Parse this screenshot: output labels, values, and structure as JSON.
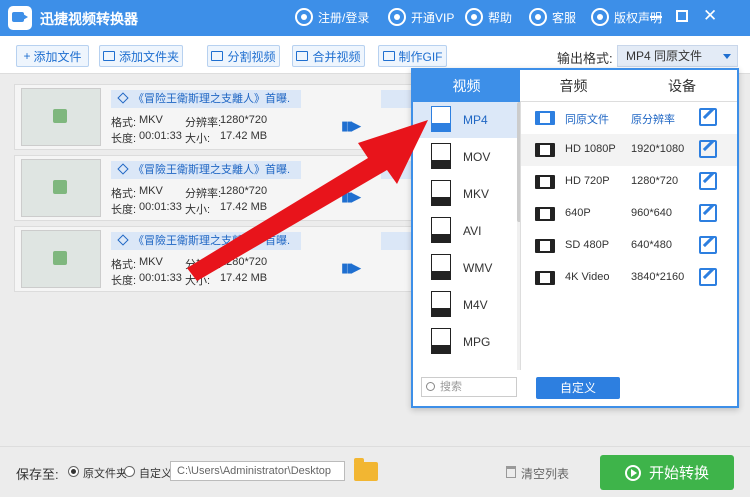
{
  "app": {
    "title": "迅捷视频转换器"
  },
  "titlebar": {
    "login": "注册/登录",
    "vip": "开通VIP",
    "help": "帮助",
    "service": "客服",
    "copyright": "版权声明"
  },
  "toolbar": {
    "add_file": "添加文件",
    "add_folder": "添加文件夹",
    "split_video": "分割视频",
    "merge_video": "合并视频",
    "make_gif": "制作GIF",
    "output_label": "输出格式:",
    "output_value": "MP4  同原文件"
  },
  "files": [
    {
      "title": "《冒险王衛斯理之支離人》首曝.",
      "format_label": "格式:",
      "format": "MKV",
      "res_label": "分辨率:",
      "resolution": "1280*720",
      "duration_label": "长度:",
      "duration": "00:01:33",
      "size_label": "大小:",
      "size": "17.42 MB"
    },
    {
      "title": "《冒險王衛斯理之支離人》首曝.",
      "format_label": "格式:",
      "format": "MKV",
      "res_label": "分辨率:",
      "resolution": "1280*720",
      "duration_label": "长度:",
      "duration": "00:01:33",
      "size_label": "大小:",
      "size": "17.42 MB"
    },
    {
      "title": "《冒險王衛斯理之支離人》首曝.",
      "format_label": "格式:",
      "format": "MKV",
      "res_label": "分辨率:",
      "resolution": "1280*720",
      "duration_label": "长度:",
      "duration": "00:01:33",
      "size_label": "大小:",
      "size": "17.42 MB"
    }
  ],
  "popup": {
    "tabs": [
      "视频",
      "音频",
      "设备"
    ],
    "formats": [
      "MP4",
      "MOV",
      "MKV",
      "AVI",
      "WMV",
      "M4V",
      "MPG"
    ],
    "resolutions": [
      {
        "name": "同原文件",
        "res": "原分辨率"
      },
      {
        "name": "HD 1080P",
        "res": "1920*1080"
      },
      {
        "name": "HD 720P",
        "res": "1280*720"
      },
      {
        "name": "640P",
        "res": "960*640"
      },
      {
        "name": "SD 480P",
        "res": "640*480"
      },
      {
        "name": "4K Video",
        "res": "3840*2160"
      }
    ],
    "search_placeholder": "搜索",
    "custom": "自定义"
  },
  "bottom": {
    "save_to": "保存至:",
    "opt_source": "原文件夹",
    "opt_custom": "自定义",
    "path": "C:\\Users\\Administrator\\Desktop",
    "clear": "清空列表",
    "start": "开始转换"
  },
  "colors": {
    "accent": "#3d8fe8",
    "start": "#3eb44a",
    "arrow": "#e8141b"
  }
}
